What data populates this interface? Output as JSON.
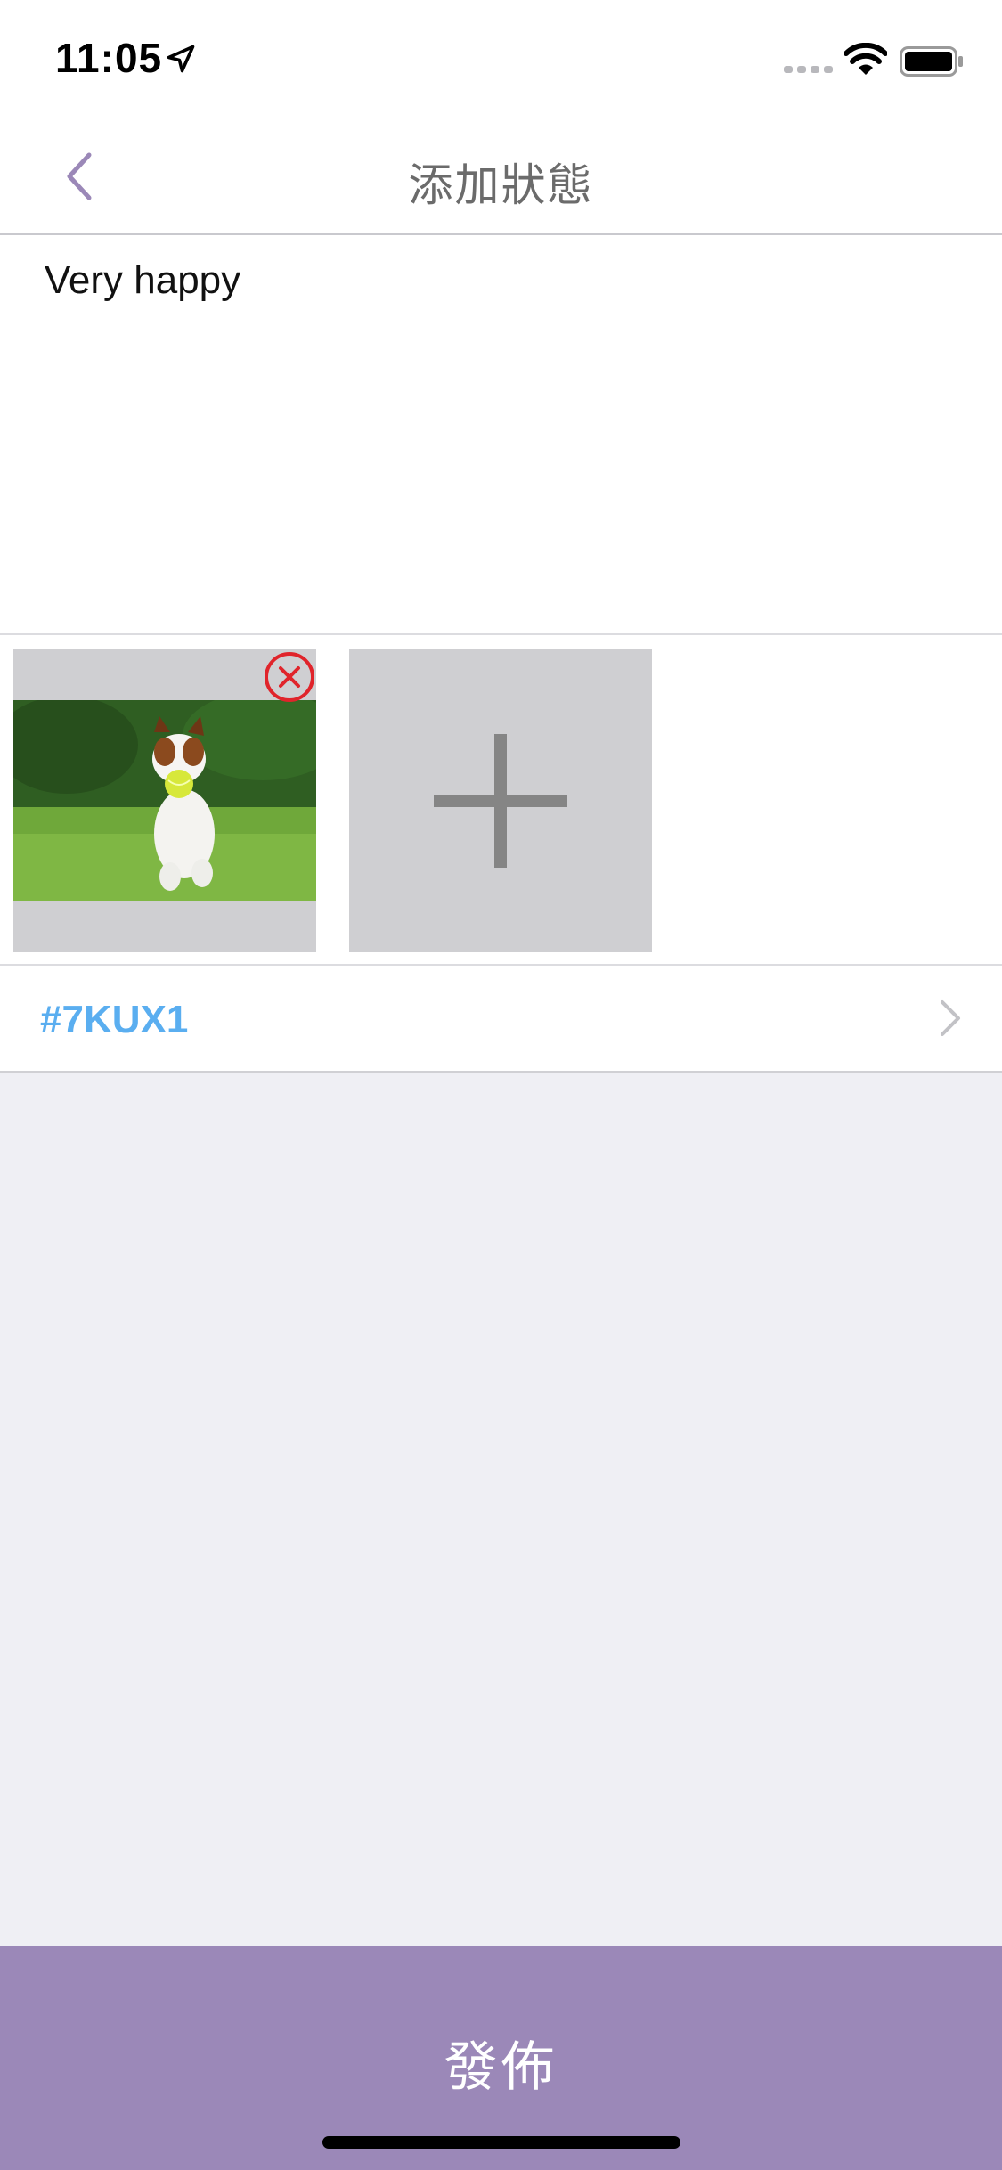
{
  "status_bar": {
    "time": "11:05",
    "icons": [
      "location-arrow-icon",
      "cellular-signal-icon",
      "wifi-icon",
      "battery-icon"
    ]
  },
  "nav": {
    "title": "添加狀態",
    "back_icon": "chevron-left-icon"
  },
  "post": {
    "text": "Very happy"
  },
  "photos": {
    "items": [
      {
        "name": "dog-photo",
        "description_icon": "photo-thumbnail"
      }
    ],
    "remove_icon": "close-circle-icon",
    "add_icon": "plus-icon"
  },
  "tag": {
    "label": "#7KUX1",
    "icon": "chevron-right-icon"
  },
  "footer": {
    "publish_label": "發佈"
  },
  "colors": {
    "accent": "#9b88b8",
    "tag": "#5aaef0",
    "remove": "#e0242b",
    "placeholder_tile": "#cfcfd2",
    "background": "#efeff4"
  }
}
